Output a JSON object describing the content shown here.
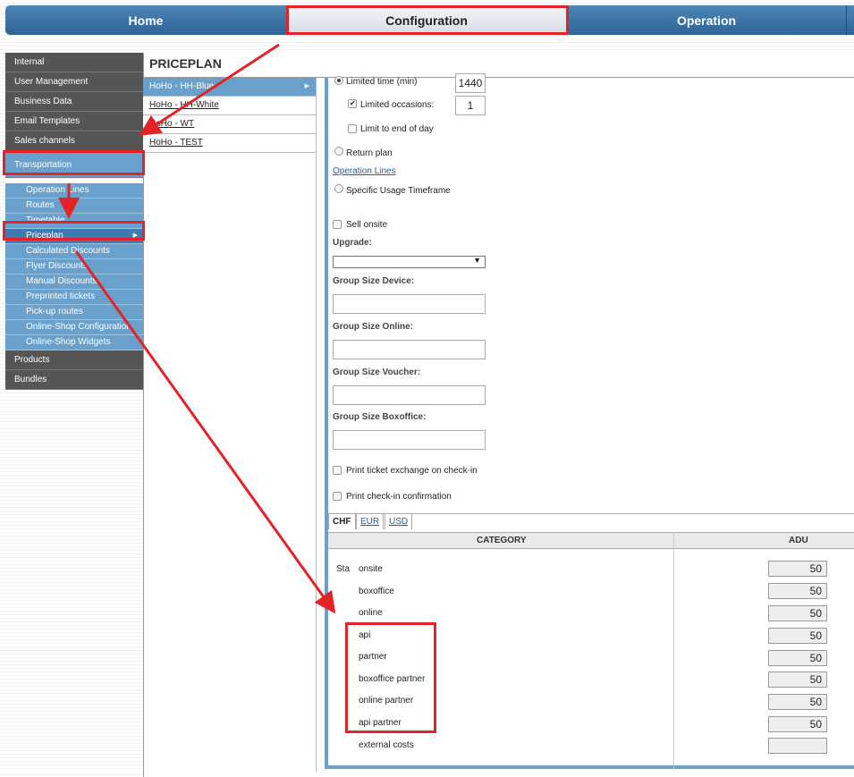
{
  "topnav": {
    "tabs": [
      {
        "label": "Home"
      },
      {
        "label": "Configuration"
      },
      {
        "label": "Operation"
      }
    ]
  },
  "sidebar": {
    "items": [
      {
        "label": "Internal"
      },
      {
        "label": "User Management"
      },
      {
        "label": "Business Data"
      },
      {
        "label": "Email Templates"
      },
      {
        "label": "Sales channels"
      },
      {
        "label": "Transportation"
      }
    ],
    "sub_items": [
      {
        "label": "Operation Lines"
      },
      {
        "label": "Routes"
      },
      {
        "label": "Timetable"
      },
      {
        "label": "Priceplan"
      },
      {
        "label": "Calculated Discounts"
      },
      {
        "label": "Flyer Discounts"
      },
      {
        "label": "Manual Discounts"
      },
      {
        "label": "Preprinted tickets"
      },
      {
        "label": "Pick-up routes"
      },
      {
        "label": "Online-Shop Configuration"
      },
      {
        "label": "Online-Shop Widgets"
      }
    ],
    "bottom_items": [
      {
        "label": "Products"
      },
      {
        "label": "Bundles"
      }
    ]
  },
  "page": {
    "title": "PRICEPLAN"
  },
  "priceplans": [
    {
      "label": "HoHo - HH-Blue"
    },
    {
      "label": "HoHo - HH-White"
    },
    {
      "label": "HoHo - WT"
    },
    {
      "label": "HoHo - TEST"
    }
  ],
  "form": {
    "limited_time_label": "Limited time (min)",
    "limited_time_value": "1440",
    "limited_occasions_label": "Limited occasions:",
    "limited_occasions_value": "1",
    "limit_end_of_day_label": "Limit to end of day",
    "return_plan_label": "Return plan",
    "operation_lines_link": "Operation Lines",
    "specific_usage_label": "Specific Usage Timeframe",
    "sell_onsite_label": "Sell onsite",
    "upgrade_label": "Upgrade:",
    "group_size_device_label": "Group Size Device:",
    "group_size_online_label": "Group Size Online:",
    "group_size_voucher_label": "Group Size Voucher:",
    "group_size_boxoffice_label": "Group Size Boxoffice:",
    "print_exchange_label": "Print ticket exchange on check-in",
    "print_confirmation_label": "Print check-in confirmation"
  },
  "currency_tabs": [
    {
      "label": "CHF"
    },
    {
      "label": "EUR"
    },
    {
      "label": "USD"
    }
  ],
  "table": {
    "col_category": "CATEGORY",
    "col_adu": "ADU",
    "row_prefix": "Sta",
    "rows": [
      {
        "category": "onsite",
        "adu": "50"
      },
      {
        "category": "boxoffice",
        "adu": "50"
      },
      {
        "category": "online",
        "adu": "50"
      },
      {
        "category": "api",
        "adu": "50"
      },
      {
        "category": "partner",
        "adu": "50"
      },
      {
        "category": "boxoffice partner",
        "adu": "50"
      },
      {
        "category": "online partner",
        "adu": "50"
      },
      {
        "category": "api partner",
        "adu": "50"
      },
      {
        "category": "external costs",
        "adu": ""
      }
    ]
  },
  "colors": {
    "nav_blue": "#2e6396",
    "sidebar_dark": "#555555",
    "sidebar_blue": "#6aa0cc",
    "annotation_red": "#e32327"
  }
}
